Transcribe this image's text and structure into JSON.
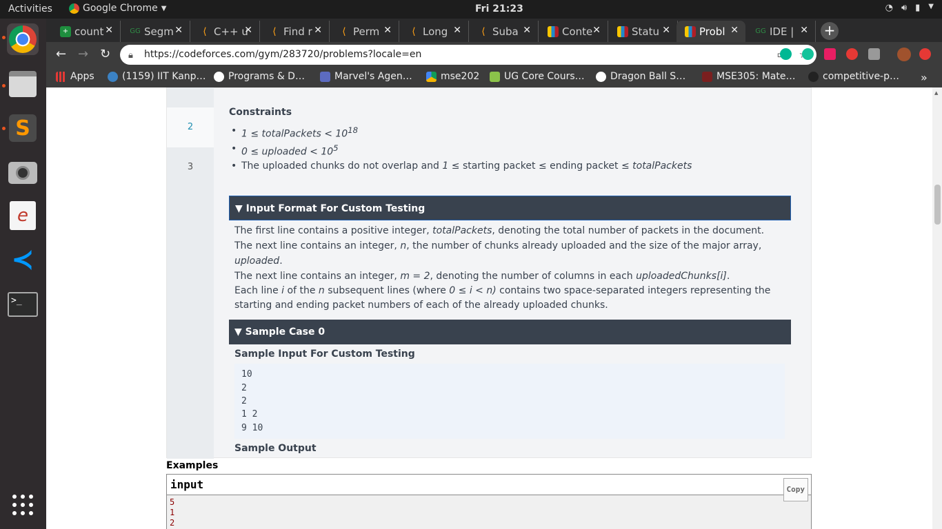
{
  "system": {
    "activities": "Activities",
    "app_name": "Google Chrome",
    "clock": "Fri 21:23"
  },
  "tabs": [
    {
      "title": "count",
      "favicon": "plus-green",
      "color": "#1e8e3e"
    },
    {
      "title": "Segm",
      "favicon": "gfg",
      "color": "#2f8d46"
    },
    {
      "title": "C++ u",
      "favicon": "leetcode",
      "color": "#ffa116"
    },
    {
      "title": "Find r",
      "favicon": "leetcode",
      "color": "#ffa116"
    },
    {
      "title": "Perm",
      "favicon": "leetcode",
      "color": "#ffa116"
    },
    {
      "title": "Long",
      "favicon": "leetcode",
      "color": "#ffa116"
    },
    {
      "title": "Suba",
      "favicon": "leetcode",
      "color": "#ffa116"
    },
    {
      "title": "Conte",
      "favicon": "codeforces",
      "color": "#1f8acb"
    },
    {
      "title": "Statu",
      "favicon": "codeforces",
      "color": "#1f8acb"
    },
    {
      "title": "Probl",
      "favicon": "codeforces",
      "color": "#1f8acb"
    },
    {
      "title": "IDE |",
      "favicon": "gfg",
      "color": "#2f8d46"
    }
  ],
  "url": "https://codeforces.com/gym/283720/problems?locale=en",
  "bookmarks": [
    "Apps",
    "(1159) IIT Kanp…",
    "Programs & D…",
    "Marvel's Agen…",
    "mse202",
    "UG Core Cours…",
    "Dragon Ball S…",
    "MSE305: Mate…",
    "competitive-p…"
  ],
  "problem": {
    "line_numbers": [
      "2",
      "3"
    ],
    "constraints_title": "Constraints",
    "c1": {
      "a": "1 ≤ totalPackets < 10",
      "exp": "18"
    },
    "c2": {
      "a": "0 ≤  uploaded < 10",
      "exp": "5"
    },
    "c3": {
      "a": "The uploaded chunks do not overlap and ",
      "b": " 1 ≤ ",
      "c": "starting packet ≤ ending packet ≤ ",
      "d": "totalPackets"
    },
    "input_format_title": "Input Format For Custom Testing",
    "if1": {
      "a": "The first line contains a positive integer, ",
      "b": "totalPackets",
      "c": ", denoting the total number of packets in the document."
    },
    "if2": {
      "a": "The next line contains an integer, ",
      "b": "n",
      "c": ", the number of chunks already uploaded and the size of the major array, ",
      "d": "uploaded",
      "e": "."
    },
    "if3": {
      "a": "The next line contains an integer, ",
      "b": "m = 2",
      "c": ", denoting the number of columns in each ",
      "d": "uploadedChunks[i]",
      "e": "."
    },
    "if4": {
      "a": "Each line ",
      "b": "i",
      "c": " of the ",
      "d": "n",
      "e": " subsequent lines (where ",
      "f": "0 ≤ i < n)",
      "g": " contains two space-separated integers representing the starting and ending packet numbers of each of the already uploaded chunks."
    },
    "sample_title": "Sample Case 0",
    "sample_input_title": "Sample Input For Custom Testing",
    "sample_input": [
      "10",
      "2",
      "2",
      "1 2",
      "9 10"
    ],
    "sample_output_title": "Sample Output"
  },
  "examples": {
    "title": "Examples",
    "input_label": "input",
    "copy": "Copy",
    "lines": [
      "5",
      "1",
      "2"
    ]
  }
}
